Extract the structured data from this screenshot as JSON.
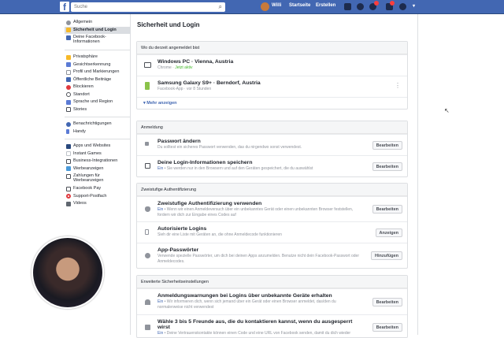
{
  "topbar": {
    "logo": "f",
    "search_placeholder": "Suche",
    "user": "Willi",
    "home": "Startseite",
    "create": "Erstellen",
    "icons": [
      "friends-icon",
      "messenger-icon",
      "notifications-icon",
      "quick-help-icon",
      "help-icon",
      "dropdown-icon"
    ]
  },
  "sidebar": {
    "group1": [
      "Allgemein",
      "Sicherheit und Login",
      "Deine Facebook-Informationen"
    ],
    "group2": [
      "Privatsphäre",
      "Gesichtserkennung",
      "Profil und Markierungen",
      "Öffentliche Beiträge",
      "Blockieren",
      "Standort",
      "Sprache und Region",
      "Stories"
    ],
    "group3": [
      "Benachrichtigungen",
      "Handy"
    ],
    "group4": [
      "Apps und Websites",
      "Instant Games",
      "Business-Integrationen",
      "Werbeanzeigen",
      "Zahlungen für Werbeanzeigen",
      "Facebook Pay",
      "Support-Postfach",
      "Videos"
    ],
    "selected": "Sicherheit und Login"
  },
  "main": {
    "title": "Sicherheit und Login",
    "where": {
      "header": "Wo du derzeit angemeldet bist",
      "sessions": [
        {
          "device": "Windows PC · Vienna, Austria",
          "app": "Chrome · ",
          "status": "Jetzt aktiv"
        },
        {
          "device": "Samsung Galaxy S9+ · Berndorf, Austria",
          "app": "Facebook-App · vor 8 Stunden"
        }
      ],
      "more": "Mehr anzeigen"
    },
    "login": {
      "header": "Anmeldung",
      "rows": [
        {
          "title": "Passwort ändern",
          "desc": "Du solltest ein sicheres Passwort verwenden, das du nirgendwo sonst verwendest.",
          "button": "Bearbeiten"
        },
        {
          "title": "Deine Login-Informationen speichern",
          "status": "Ein",
          "desc": " • Sie werden nur in den Browsern und auf den Geräten gespeichert, die du auswählst",
          "button": "Bearbeiten"
        }
      ]
    },
    "twofa": {
      "header": "Zweistufige Authentifizierung",
      "rows": [
        {
          "title": "Zweistufige Authentifizierung verwenden",
          "status": "Ein",
          "desc": " • Wenn wir einen Anmeldeversuch über ein unbekanntes Gerät oder einen unbekannten Browser feststellen, fordern wir dich zur Eingabe eines Codes auf",
          "button": "Bearbeiten"
        },
        {
          "title": "Autorisierte Logins",
          "desc": "Sieh dir eine Liste mit Geräten an, die ohne Anmeldecode funktionieren",
          "button": "Anzeigen"
        },
        {
          "title": "App-Passwörter",
          "desc": "Verwende spezielle Passwörter, um dich bei deinen Apps anzumelden. Benutze nicht dein Facebook-Passwort oder Anmeldecodes.",
          "button": "Hinzufügen"
        }
      ]
    },
    "advanced": {
      "header": "Erweiterte Sicherheitseinstellungen",
      "rows": [
        {
          "title": "Anmeldungswarnungen bei Logins über unbekannte Geräte erhalten",
          "status": "Ein",
          "desc": " • Wir informieren dich, wenn sich jemand über ein Gerät oder einen Browser anmeldet, das/den du normalerweise nicht verwendest",
          "button": "Bearbeiten"
        },
        {
          "title": "Wähle 3 bis 5 Freunde aus, die du kontaktieren kannst, wenn du ausgesperrt wirst",
          "status": "Ein",
          "desc": " • Deine Vertrauenskontakte können einen Code und eine URL von Facebook senden, damit du dich wieder",
          "button": "Bearbeiten"
        }
      ]
    }
  }
}
